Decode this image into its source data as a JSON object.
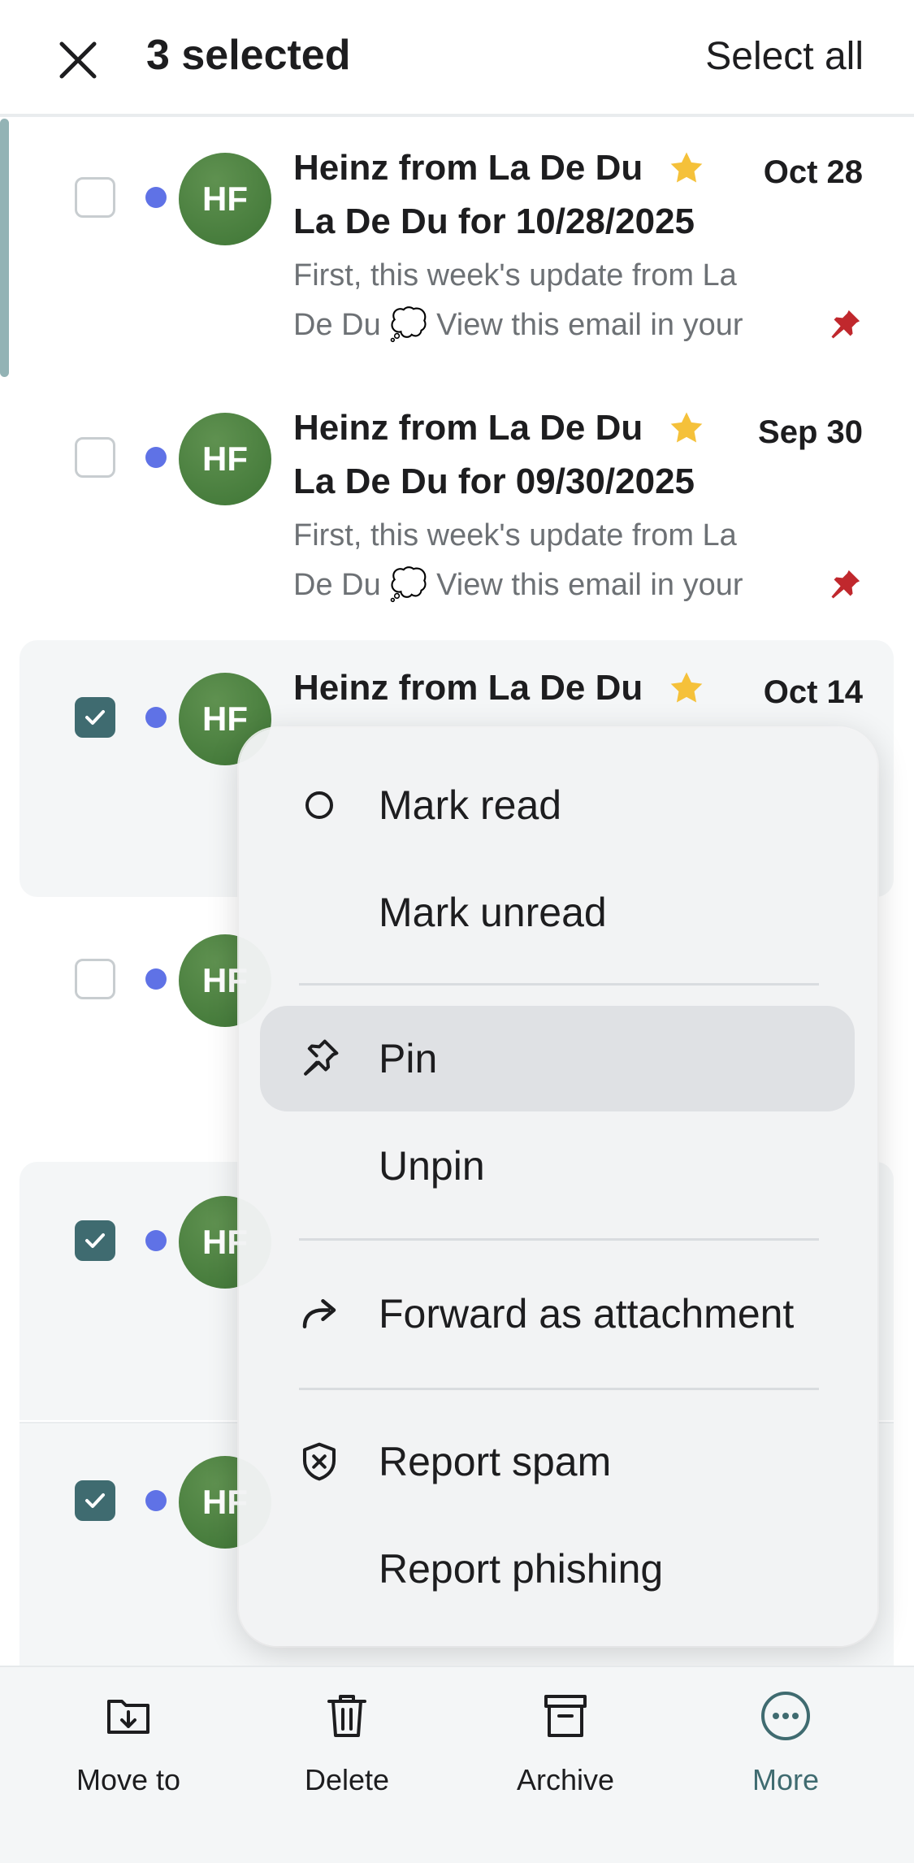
{
  "header": {
    "title": "3 selected",
    "select_all": "Select all"
  },
  "emails": [
    {
      "sender": "Heinz from La De Du",
      "date": "Oct 28",
      "subject": "La De Du for 10/28/2025",
      "preview_line1": "First, this week's update from La",
      "preview_line2": "De Du 💭 View this email in your",
      "avatar": "HF",
      "checked": false,
      "unread": true,
      "starred": true,
      "pinned": true
    },
    {
      "sender": "Heinz from La De Du",
      "date": "Sep 30",
      "subject": "La De Du for 09/30/2025",
      "preview_line1": "First, this week's update from La",
      "preview_line2": "De Du 💭 View this email in your",
      "avatar": "HF",
      "checked": false,
      "unread": true,
      "starred": true,
      "pinned": true
    },
    {
      "sender": "Heinz from La De Du",
      "date": "Oct 14",
      "avatar": "HF",
      "checked": true,
      "unread": true,
      "starred": true
    },
    {
      "avatar": "HF",
      "checked": false,
      "unread": true
    },
    {
      "avatar": "HF",
      "checked": true,
      "unread": true
    },
    {
      "avatar": "HF",
      "checked": true,
      "unread": true
    }
  ],
  "menu": {
    "mark_read": "Mark read",
    "mark_unread": "Mark unread",
    "pin": "Pin",
    "unpin": "Unpin",
    "forward_attachment": "Forward as attachment",
    "report_spam": "Report spam",
    "report_phishing": "Report phishing"
  },
  "toolbar": {
    "move_to": "Move to",
    "delete": "Delete",
    "archive": "Archive",
    "more": "More"
  },
  "colors": {
    "accent": "#3f6b70",
    "unread_dot": "#5f72e6",
    "avatar": "#4a7d3f",
    "star": "#f5c13a",
    "pin": "#c0282d"
  },
  "icons": {
    "close": "close-icon",
    "star": "star-icon",
    "pin_red": "pin-icon",
    "menu_mark_read": "circle-icon",
    "menu_pin": "pin-outline-icon",
    "menu_forward": "forward-arrow-icon",
    "menu_spam": "shield-x-icon",
    "move_to": "folder-download-icon",
    "delete": "trash-icon",
    "archive": "archive-box-icon",
    "more": "more-circle-icon"
  }
}
